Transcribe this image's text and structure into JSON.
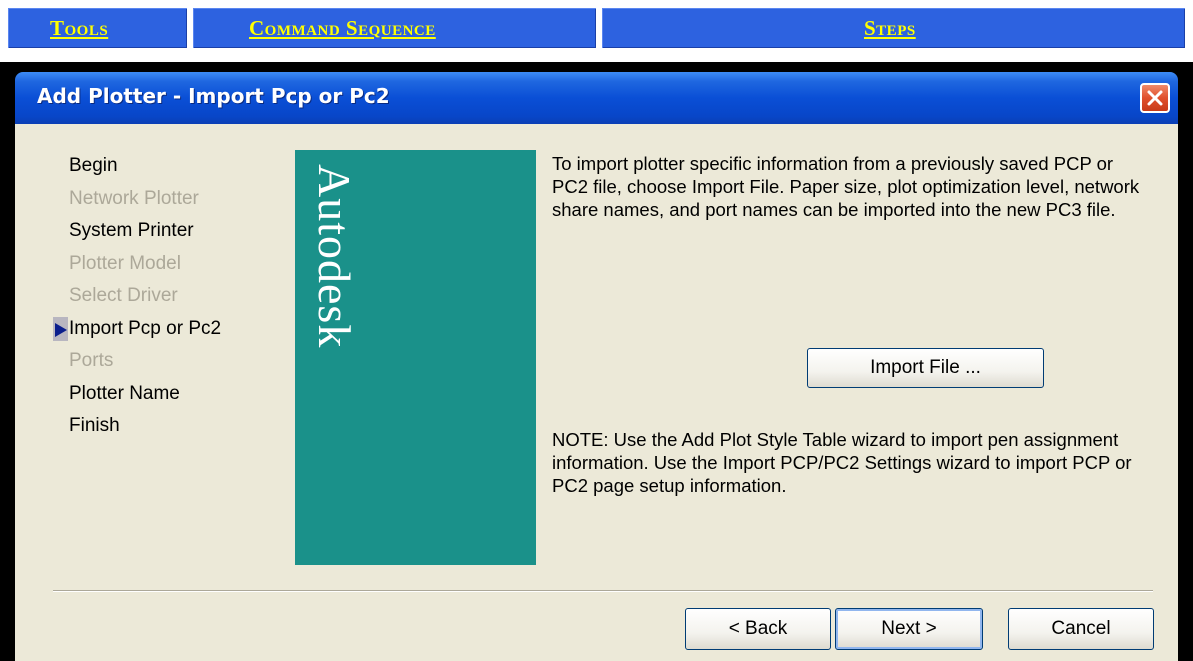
{
  "nav": {
    "tools": "Tools",
    "command_sequence": "Command Sequence",
    "steps": "Steps"
  },
  "dialog": {
    "title": "Add Plotter - Import Pcp or Pc2",
    "close_icon": "close-icon",
    "steps": [
      {
        "label": "Begin",
        "state": "enabled"
      },
      {
        "label": "Network Plotter",
        "state": "disabled"
      },
      {
        "label": "System Printer",
        "state": "enabled"
      },
      {
        "label": "Plotter Model",
        "state": "disabled"
      },
      {
        "label": "Select Driver",
        "state": "disabled"
      },
      {
        "label": "Import Pcp or Pc2",
        "state": "current"
      },
      {
        "label": "Ports",
        "state": "disabled"
      },
      {
        "label": "Plotter Name",
        "state": "enabled"
      },
      {
        "label": "Finish",
        "state": "enabled"
      }
    ],
    "banner_text": "Autodesk",
    "description": "To import plotter specific information from a previously saved PCP or PC2 file, choose Import File. Paper size, plot optimization level, network share names, and port names can be imported into the new PC3 file.",
    "import_button": "Import File ...",
    "note": "NOTE: Use the Add Plot Style Table wizard to import pen assignment information. Use the Import PCP/PC2 Settings wizard to import PCP or PC2 page setup information.",
    "back_button": "< Back",
    "next_button": "Next >",
    "cancel_button": "Cancel"
  },
  "colors": {
    "nav_bg": "#2d62e0",
    "nav_link": "#ffff00",
    "titlebar": "#0a4fd6",
    "client_bg": "#ece9d8",
    "banner_bg": "#1a918a",
    "disabled_text": "#aca899"
  }
}
